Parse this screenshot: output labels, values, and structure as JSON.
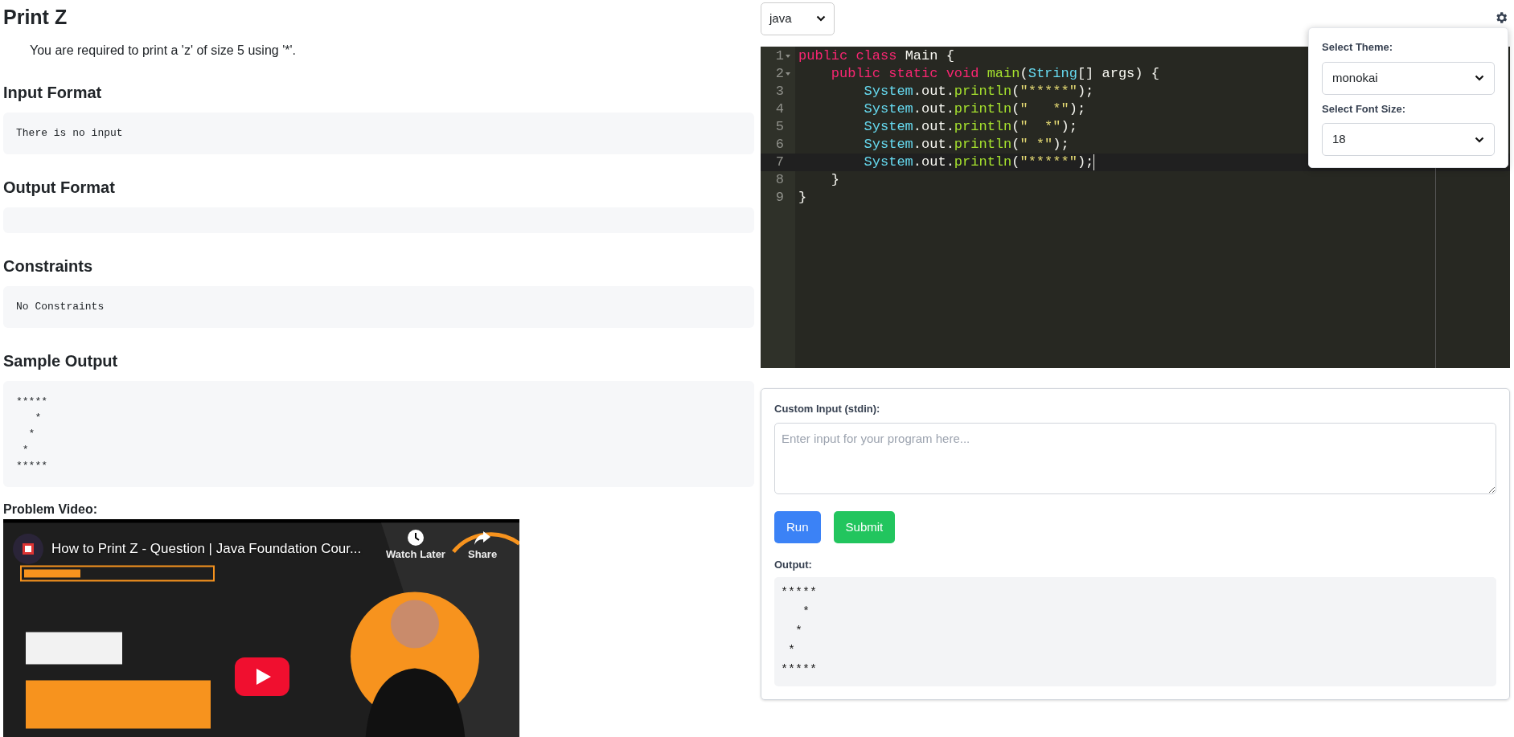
{
  "problem": {
    "title": "Print Z",
    "description": "You are required to print a 'z' of size 5 using '*'.",
    "sections": [
      {
        "heading": "Input Format",
        "content": "There is no input"
      },
      {
        "heading": "Output Format"
      },
      {
        "heading": "Constraints",
        "content": "No Constraints"
      },
      {
        "heading": "Sample Output",
        "content": "*****\n   *\n  *\n *\n*****"
      }
    ]
  },
  "video": {
    "label": "Problem Video:",
    "title": "How to Print Z - Question | Java Foundation Cour...",
    "watch_later": "Watch Later",
    "share": "Share"
  },
  "editor": {
    "language": "java",
    "settings": {
      "theme_label": "Select Theme:",
      "theme": "monokai",
      "font_size_label": "Select Font Size:",
      "font_size": "18"
    },
    "lines": [
      {
        "number": "1",
        "foldable": true,
        "active": false,
        "tokens": [
          {
            "kind": "keyword",
            "text": "public"
          },
          {
            "kind": "keyword",
            "text": " class"
          },
          {
            "kind": "plain",
            "text": " Main {"
          }
        ]
      },
      {
        "number": "2",
        "foldable": true,
        "active": false,
        "tokens": [
          {
            "kind": "keyword",
            "text": "    public"
          },
          {
            "kind": "keyword",
            "text": " static"
          },
          {
            "kind": "keyword",
            "text": " void"
          },
          {
            "kind": "function",
            "text": " main"
          },
          {
            "kind": "plain",
            "text": "("
          },
          {
            "kind": "type",
            "text": "String"
          },
          {
            "kind": "plain",
            "text": "[] args) {"
          }
        ]
      },
      {
        "number": "3",
        "foldable": false,
        "active": false,
        "tokens": [
          {
            "kind": "type",
            "text": "        System"
          },
          {
            "kind": "plain",
            "text": ".out."
          },
          {
            "kind": "function",
            "text": "println"
          },
          {
            "kind": "plain",
            "text": "("
          },
          {
            "kind": "string",
            "text": "\"*****\""
          },
          {
            "kind": "plain",
            "text": ");"
          }
        ]
      },
      {
        "number": "4",
        "foldable": false,
        "active": false,
        "tokens": [
          {
            "kind": "type",
            "text": "        System"
          },
          {
            "kind": "plain",
            "text": ".out."
          },
          {
            "kind": "function",
            "text": "println"
          },
          {
            "kind": "plain",
            "text": "("
          },
          {
            "kind": "string",
            "text": "\"   *\""
          },
          {
            "kind": "plain",
            "text": ");"
          }
        ]
      },
      {
        "number": "5",
        "foldable": false,
        "active": false,
        "tokens": [
          {
            "kind": "type",
            "text": "        System"
          },
          {
            "kind": "plain",
            "text": ".out."
          },
          {
            "kind": "function",
            "text": "println"
          },
          {
            "kind": "plain",
            "text": "("
          },
          {
            "kind": "string",
            "text": "\"  *\""
          },
          {
            "kind": "plain",
            "text": ");"
          }
        ]
      },
      {
        "number": "6",
        "foldable": false,
        "active": false,
        "tokens": [
          {
            "kind": "type",
            "text": "        System"
          },
          {
            "kind": "plain",
            "text": ".out."
          },
          {
            "kind": "function",
            "text": "println"
          },
          {
            "kind": "plain",
            "text": "("
          },
          {
            "kind": "string",
            "text": "\" *\""
          },
          {
            "kind": "plain",
            "text": ");"
          }
        ]
      },
      {
        "number": "7",
        "foldable": false,
        "active": true,
        "tokens": [
          {
            "kind": "type",
            "text": "        System"
          },
          {
            "kind": "plain",
            "text": ".out."
          },
          {
            "kind": "function",
            "text": "println"
          },
          {
            "kind": "plain",
            "text": "("
          },
          {
            "kind": "string",
            "text": "\"*****\""
          },
          {
            "kind": "plain",
            "text": ");"
          }
        ]
      },
      {
        "number": "8",
        "foldable": false,
        "active": false,
        "tokens": [
          {
            "kind": "plain",
            "text": "    }"
          }
        ]
      },
      {
        "number": "9",
        "foldable": false,
        "active": false,
        "tokens": [
          {
            "kind": "plain",
            "text": "}"
          }
        ]
      }
    ]
  },
  "runner": {
    "input_label": "Custom Input (stdin):",
    "placeholder": "Enter input for your program here...",
    "buttons": [
      {
        "label": "Run",
        "kind": "run"
      },
      {
        "label": "Submit",
        "kind": "submit"
      }
    ],
    "output_label": "Output:",
    "output": "*****\n   *\n  *\n *\n*****"
  }
}
